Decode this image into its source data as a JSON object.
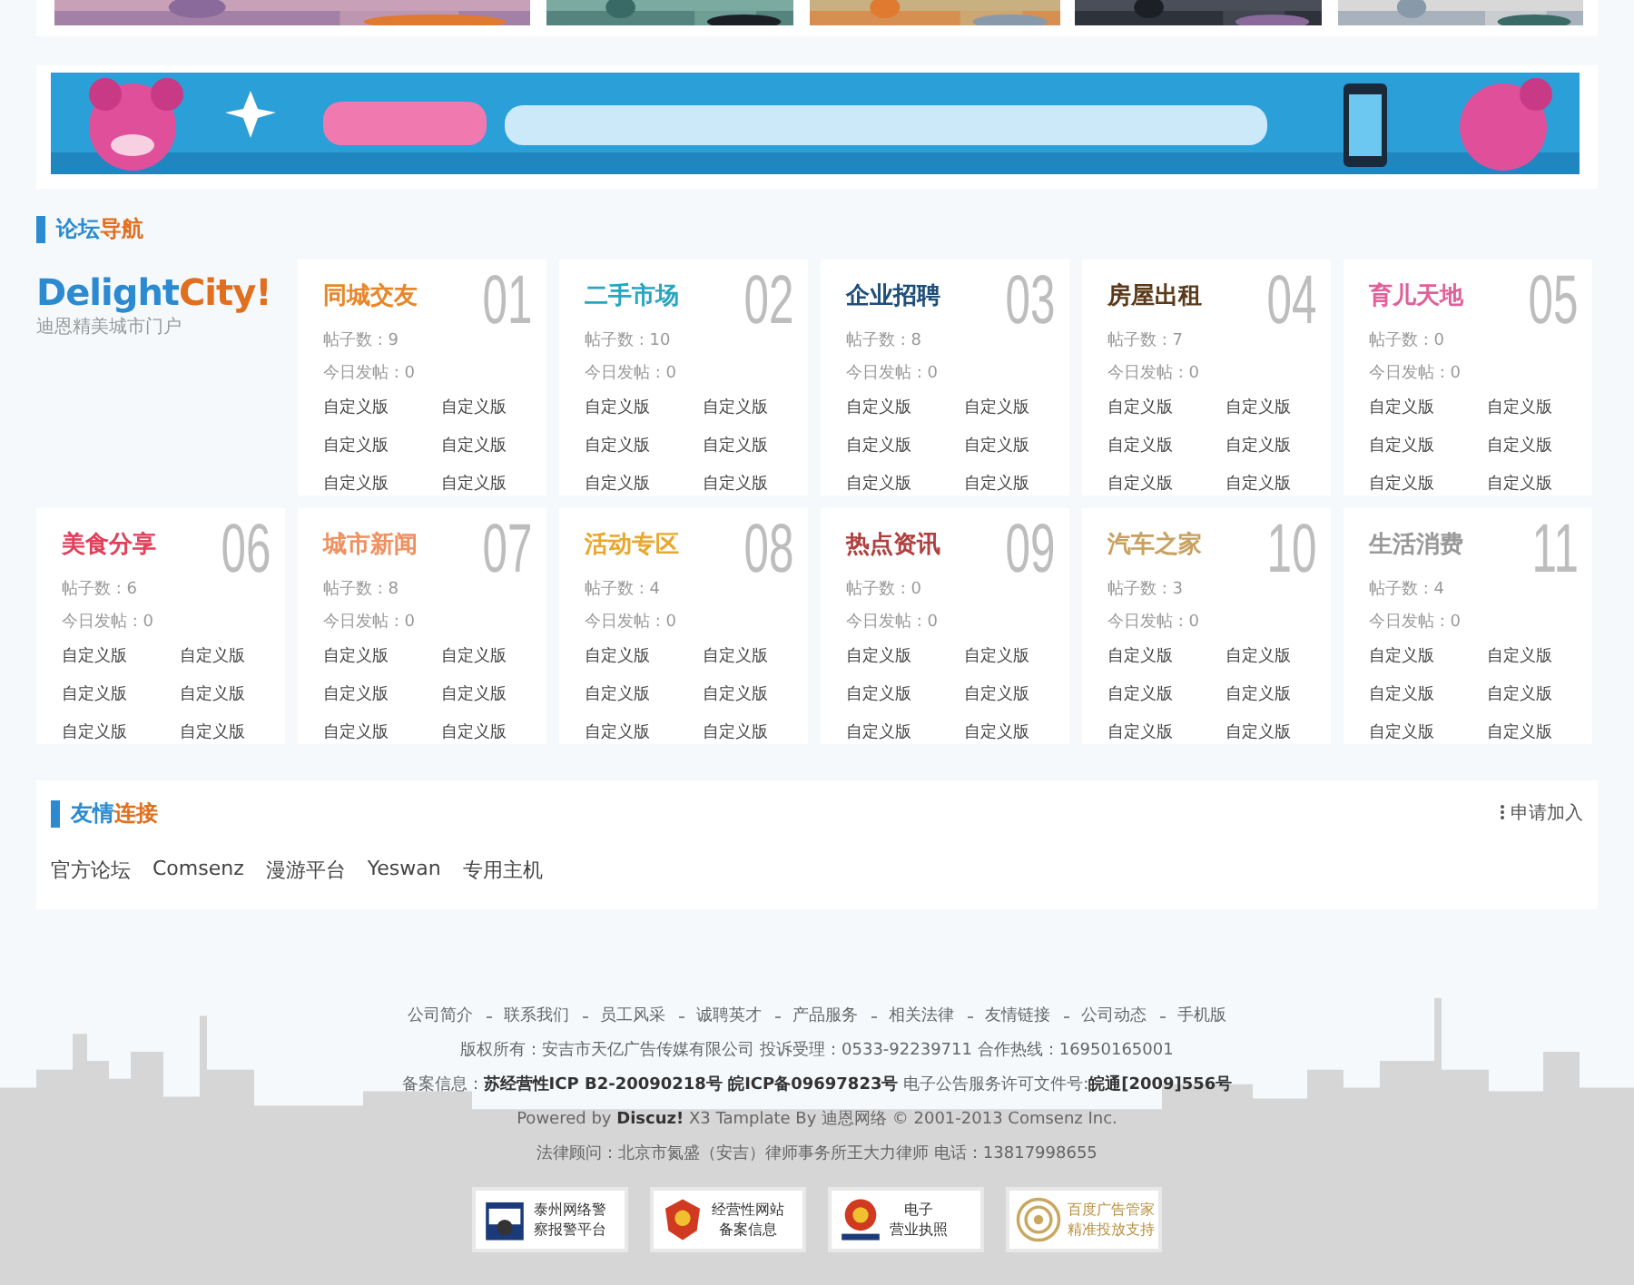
{
  "forum_nav": {
    "title": [
      "论坛",
      "导航"
    ],
    "logo": [
      "Delight",
      "City!"
    ],
    "logo_subtitle": "迪恩精美城市门户",
    "boards": [
      {
        "title": "同城交友",
        "color": "#e8862a",
        "number": "01",
        "posts": "帖子数 : 9",
        "today": "今日发帖 : 0",
        "links": [
          "自定义版",
          "自定义版",
          "自定义版",
          "自定义版",
          "自定义版",
          "自定义版"
        ]
      },
      {
        "title": "二手市场",
        "color": "#2aa5c0",
        "number": "02",
        "posts": "帖子数 : 10",
        "today": "今日发帖 : 0",
        "links": [
          "自定义版",
          "自定义版",
          "自定义版",
          "自定义版",
          "自定义版",
          "自定义版"
        ]
      },
      {
        "title": "企业招聘",
        "color": "#1f4e79",
        "number": "03",
        "posts": "帖子数 : 8",
        "today": "今日发帖 : 0",
        "links": [
          "自定义版",
          "自定义版",
          "自定义版",
          "自定义版",
          "自定义版",
          "自定义版"
        ]
      },
      {
        "title": "房屋出租",
        "color": "#5a3a1a",
        "number": "04",
        "posts": "帖子数 : 7",
        "today": "今日发帖 : 0",
        "links": [
          "自定义版",
          "自定义版",
          "自定义版",
          "自定义版",
          "自定义版",
          "自定义版"
        ]
      },
      {
        "title": "育儿天地",
        "color": "#e0609a",
        "number": "05",
        "posts": "帖子数 : 0",
        "today": "今日发帖 : 0",
        "links": [
          "自定义版",
          "自定义版",
          "自定义版",
          "自定义版",
          "自定义版",
          "自定义版"
        ]
      },
      {
        "title": "美食分享",
        "color": "#e0405a",
        "number": "06",
        "posts": "帖子数 : 6",
        "today": "今日发帖 : 0",
        "links": [
          "自定义版",
          "自定义版",
          "自定义版",
          "自定义版",
          "自定义版",
          "自定义版"
        ]
      },
      {
        "title": "城市新闻",
        "color": "#f09060",
        "number": "07",
        "posts": "帖子数 : 8",
        "today": "今日发帖 : 0",
        "links": [
          "自定义版",
          "自定义版",
          "自定义版",
          "自定义版",
          "自定义版",
          "自定义版"
        ]
      },
      {
        "title": "活动专区",
        "color": "#e8a830",
        "number": "08",
        "posts": "帖子数 : 4",
        "today": "今日发帖 : 0",
        "links": [
          "自定义版",
          "自定义版",
          "自定义版",
          "自定义版",
          "自定义版",
          "自定义版"
        ]
      },
      {
        "title": "热点资讯",
        "color": "#b04040",
        "number": "09",
        "posts": "帖子数 : 0",
        "today": "今日发帖 : 0",
        "links": [
          "自定义版",
          "自定义版",
          "自定义版",
          "自定义版",
          "自定义版",
          "自定义版"
        ]
      },
      {
        "title": "汽车之家",
        "color": "#c8a060",
        "number": "10",
        "posts": "帖子数 : 3",
        "today": "今日发帖 : 0",
        "links": [
          "自定义版",
          "自定义版",
          "自定义版",
          "自定义版",
          "自定义版",
          "自定义版"
        ]
      },
      {
        "title": "生活消费",
        "color": "#999999",
        "number": "11",
        "posts": "帖子数 : 4",
        "today": "今日发帖 : 0",
        "links": [
          "自定义版",
          "自定义版",
          "自定义版",
          "自定义版",
          "自定义版",
          "自定义版"
        ]
      }
    ]
  },
  "friend_links": {
    "title": [
      "友情",
      "连接"
    ],
    "apply": "申请加入",
    "links": [
      "官方论坛",
      "Comsenz",
      "漫游平台",
      "Yeswan",
      "专用主机"
    ]
  },
  "footer": {
    "nav": [
      "公司简介",
      "联系我们",
      "员工风采",
      "诚聘英才",
      "产品服务",
      "相关法律",
      "友情链接",
      "公司动态",
      "手机版"
    ],
    "lines": [
      "版权所有：安吉市天亿广告传媒有限公司 投诉受理：0533-92239711 合作热线：16950165001",
      "备案信息：**苏经营性ICP B2-20090218号 皖ICP备09697823号** 电子公告服务许可文件号:**皖通[2009]556号**",
      "Powered by **Discuz!** X3 Tamplate By 迪恩网络  © 2001-2013 Comsenz Inc.",
      "法律顾问：北京市氮盛（安吉）律师事务所王大力律师 电话：13817998655"
    ],
    "badges": [
      {
        "kind": "police",
        "text": [
          "泰州网络警",
          "察报警平台"
        ]
      },
      {
        "kind": "emblem",
        "text": [
          "经营性网站",
          "备案信息"
        ]
      },
      {
        "kind": "license",
        "text": [
          "电子",
          "营业执照"
        ]
      },
      {
        "kind": "target",
        "text": [
          "百度广告管家",
          "精准投放支持"
        ]
      }
    ]
  }
}
